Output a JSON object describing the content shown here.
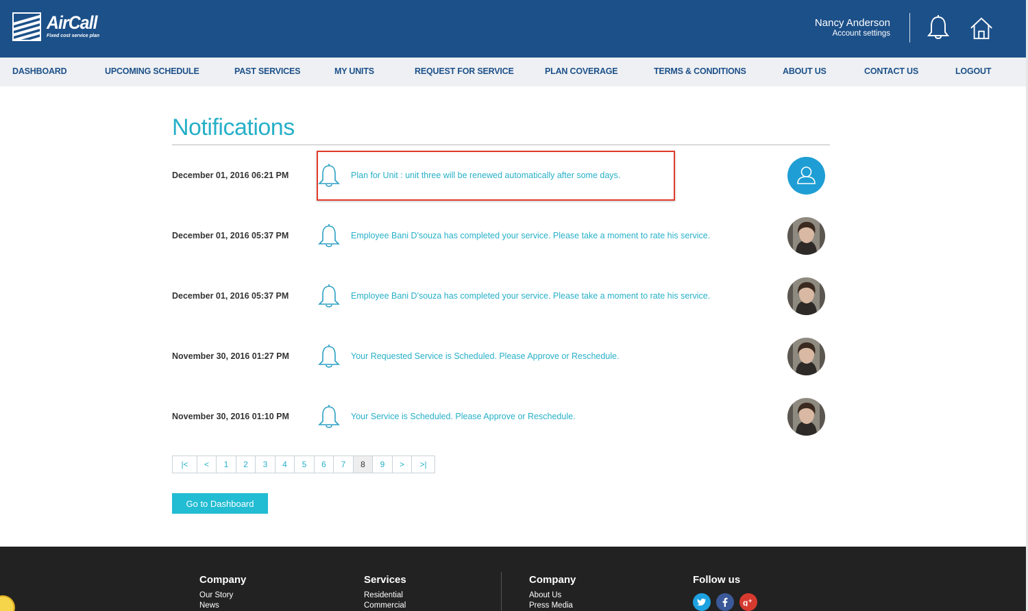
{
  "header": {
    "logo_name": "AirCall",
    "logo_tagline": "Fixed cost service plan",
    "user_name": "Nancy Anderson",
    "account_settings": "Account settings",
    "brand_color": "#1c5089"
  },
  "nav": {
    "items": [
      {
        "label": "DASHBOARD"
      },
      {
        "label": "UPCOMING SCHEDULE"
      },
      {
        "label": "PAST SERVICES"
      },
      {
        "label": "MY UNITS"
      },
      {
        "label": "REQUEST FOR SERVICE"
      },
      {
        "label": "PLAN COVERAGE"
      },
      {
        "label": "TERMS & CONDITIONS"
      },
      {
        "label": "ABOUT US"
      },
      {
        "label": "CONTACT US"
      },
      {
        "label": "LOGOUT"
      }
    ]
  },
  "main": {
    "title": "Notifications",
    "accent_color": "#27b0c8",
    "notifications": [
      {
        "date": "December 01, 2016 06:21 PM",
        "message": "Plan for Unit : unit three will be renewed automatically after some days.",
        "avatar": "default-user-icon"
      },
      {
        "date": "December 01, 2016 05:37 PM",
        "message": "Employee Bani D'souza has completed your service. Please take a moment to rate his service.",
        "avatar": "employee-photo"
      },
      {
        "date": "December 01, 2016 05:37 PM",
        "message": "Employee Bani D'souza has completed your service. Please take a moment to rate his service.",
        "avatar": "employee-photo"
      },
      {
        "date": "November 30, 2016 01:27 PM",
        "message": "Your Requested Service is Scheduled. Please Approve or Reschedule.",
        "avatar": "employee-photo"
      },
      {
        "date": "November 30, 2016 01:10 PM",
        "message": "Your Service is Scheduled. Please Approve or Reschedule.",
        "avatar": "employee-photo"
      }
    ],
    "pagination": {
      "first": "|<",
      "prev": "<",
      "pages": [
        "1",
        "2",
        "3",
        "4",
        "5",
        "6",
        "7",
        "8",
        "9"
      ],
      "next": ">",
      "last": ">|",
      "current": "8"
    },
    "dashboard_button": "Go to Dashboard"
  },
  "footer": {
    "col1": {
      "heading": "Company",
      "links": [
        "Our Story",
        "News"
      ]
    },
    "col2": {
      "heading": "Services",
      "links": [
        "Residential",
        "Commercial"
      ]
    },
    "col3": {
      "heading": "Company",
      "links": [
        "About Us",
        "Press Media"
      ]
    },
    "col4": {
      "heading": "Follow us"
    },
    "social": [
      "twitter-icon",
      "facebook-icon",
      "google-plus-icon"
    ]
  }
}
